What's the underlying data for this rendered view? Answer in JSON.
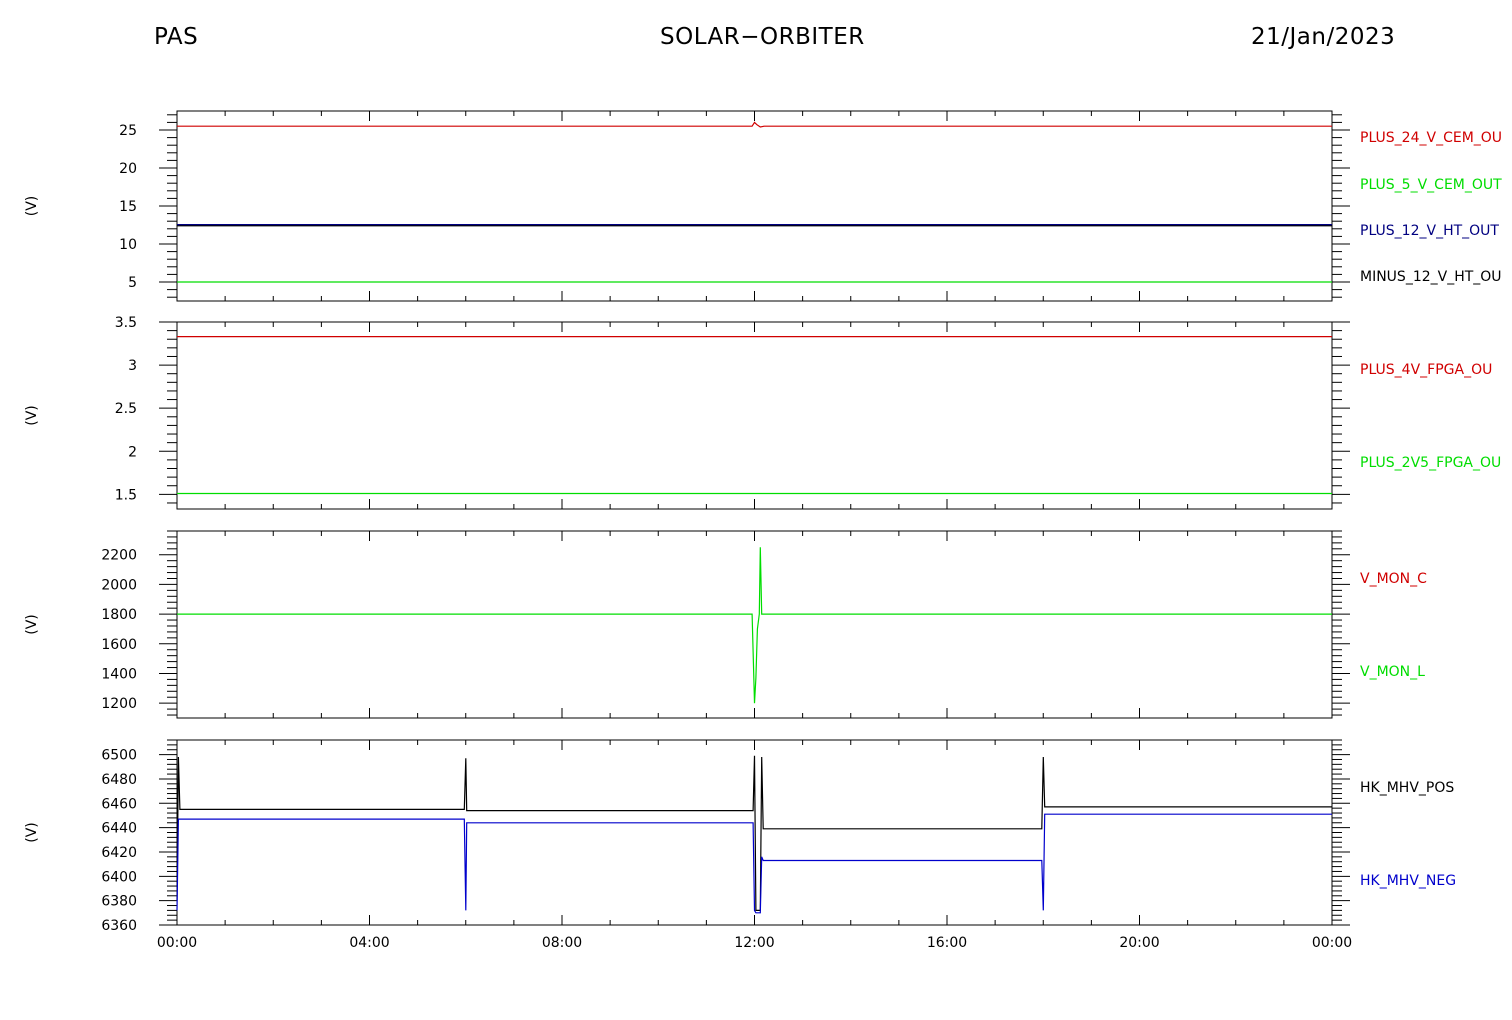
{
  "header": {
    "left": "PAS",
    "center": "SOLAR−ORBITER",
    "right": "21/Jan/2023"
  },
  "x_tick_labels": [
    "00:00",
    "04:00",
    "08:00",
    "12:00",
    "16:00",
    "20:00",
    "00:00"
  ],
  "chart_data": [
    {
      "type": "line",
      "ylabel": "(V)",
      "ylim": [
        2.5,
        27.5
      ],
      "yticks": [
        5,
        10,
        15,
        20,
        25
      ],
      "x_unit": "hours",
      "xlim": [
        0,
        24
      ],
      "series": [
        {
          "name": "PLUS_24_V_CEM_OU",
          "color": "#d00000",
          "points": [
            [
              0,
              25.5
            ],
            [
              11.95,
              25.5
            ],
            [
              12.0,
              26.0
            ],
            [
              12.05,
              25.7
            ],
            [
              12.12,
              25.4
            ],
            [
              12.2,
              25.5
            ],
            [
              24,
              25.5
            ]
          ]
        },
        {
          "name": "PLUS_5_V_CEM_OUT",
          "color": "#00dd00",
          "points": [
            [
              0,
              5.0
            ],
            [
              24,
              5.0
            ]
          ]
        },
        {
          "name": "PLUS_12_V_HT_OUT",
          "color": "#000080",
          "points": [
            [
              0,
              12.5
            ],
            [
              24,
              12.5
            ]
          ]
        },
        {
          "name": "MINUS_12_V_HT_OU",
          "color": "#000000",
          "points": [
            [
              0,
              12.4
            ],
            [
              24,
              12.4
            ]
          ]
        }
      ]
    },
    {
      "type": "line",
      "ylabel": "(V)",
      "ylim": [
        1.33,
        3.5
      ],
      "yticks": [
        1.5,
        2.0,
        2.5,
        3.0,
        3.5
      ],
      "x_unit": "hours",
      "xlim": [
        0,
        24
      ],
      "series": [
        {
          "name": "PLUS_4V_FPGA_OU",
          "color": "#d00000",
          "points": [
            [
              0,
              3.33
            ],
            [
              24,
              3.33
            ]
          ]
        },
        {
          "name": "PLUS_2V5_FPGA_OU",
          "color": "#00dd00",
          "points": [
            [
              0,
              1.51
            ],
            [
              24,
              1.51
            ]
          ]
        }
      ]
    },
    {
      "type": "line",
      "ylabel": "(V)",
      "ylim": [
        1100,
        2360
      ],
      "yticks": [
        1200,
        1400,
        1600,
        1800,
        2000,
        2200
      ],
      "x_unit": "hours",
      "xlim": [
        0,
        24
      ],
      "series": [
        {
          "name": "V_MON_C",
          "color": "#d00000",
          "points": []
        },
        {
          "name": "V_MON_L",
          "color": "#00dd00",
          "points": [
            [
              0,
              1800
            ],
            [
              11.95,
              1800
            ],
            [
              12.0,
              1200
            ],
            [
              12.03,
              1370
            ],
            [
              12.06,
              1700
            ],
            [
              12.1,
              1800
            ],
            [
              12.12,
              2250
            ],
            [
              12.15,
              1800
            ],
            [
              24,
              1800
            ]
          ]
        }
      ]
    },
    {
      "type": "line",
      "ylabel": "(V)",
      "ylim": [
        6360,
        6512
      ],
      "yticks": [
        6360,
        6380,
        6400,
        6420,
        6440,
        6460,
        6480,
        6500
      ],
      "x_unit": "hours",
      "xlim": [
        0,
        24
      ],
      "series": [
        {
          "name": "HK_MHV_POS",
          "color": "#000000",
          "points": [
            [
              0,
              6380
            ],
            [
              0.03,
              6498
            ],
            [
              0.06,
              6455
            ],
            [
              5.97,
              6455
            ],
            [
              6.0,
              6497
            ],
            [
              6.02,
              6454
            ],
            [
              11.97,
              6454
            ],
            [
              12.0,
              6499
            ],
            [
              12.03,
              6372
            ],
            [
              12.12,
              6372
            ],
            [
              12.15,
              6498
            ],
            [
              12.18,
              6439
            ],
            [
              17.97,
              6439
            ],
            [
              18.0,
              6498
            ],
            [
              18.03,
              6457
            ],
            [
              24,
              6457
            ]
          ]
        },
        {
          "name": "HK_MHV_NEG",
          "color": "#0000cc",
          "points": [
            [
              0,
              6372
            ],
            [
              0.03,
              6447
            ],
            [
              5.97,
              6447
            ],
            [
              6.0,
              6372
            ],
            [
              6.02,
              6444
            ],
            [
              11.97,
              6444
            ],
            [
              12.0,
              6372
            ],
            [
              12.03,
              6370
            ],
            [
              12.12,
              6370
            ],
            [
              12.15,
              6416
            ],
            [
              12.18,
              6413
            ],
            [
              17.97,
              6413
            ],
            [
              18.0,
              6372
            ],
            [
              18.03,
              6451
            ],
            [
              24,
              6451
            ]
          ]
        }
      ]
    }
  ]
}
